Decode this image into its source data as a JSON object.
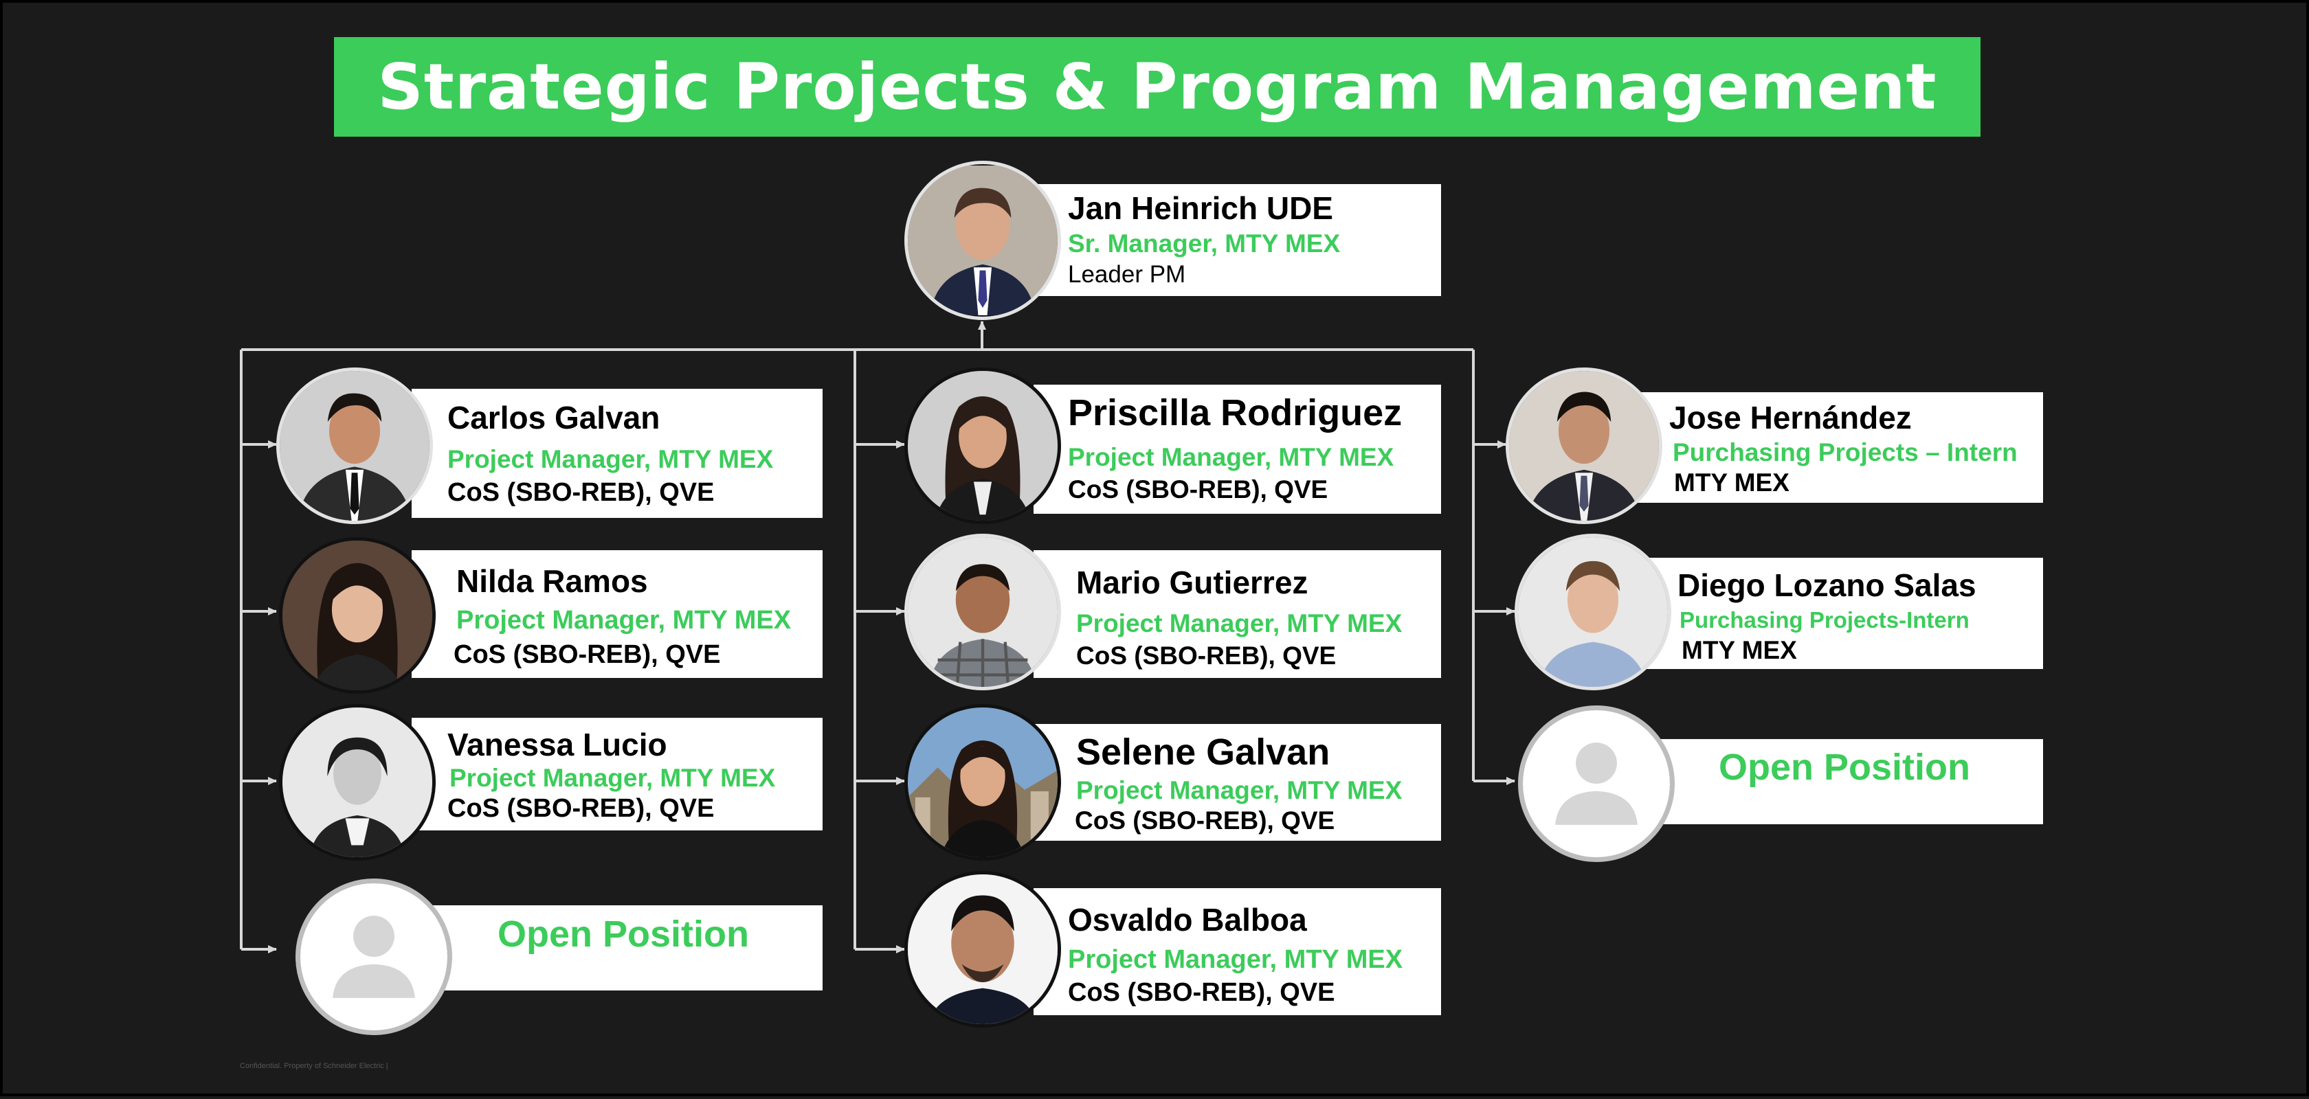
{
  "title": "Strategic Projects & Program Management",
  "colors": {
    "accent": "#3ccc5a",
    "background": "#1b1b1b",
    "card": "#ffffff",
    "connector": "#d8d8d8"
  },
  "footnote": "Confidential. Property of Schneider Electric |",
  "leader": {
    "name": "Jan Heinrich UDE",
    "role": "Sr. Manager, MTY MEX",
    "org": "Leader PM",
    "photo": "business-man-blue-tie"
  },
  "col1": [
    {
      "name": "Carlos Galvan",
      "role": "Project Manager, MTY MEX",
      "org": "CoS (SBO-REB), QVE",
      "photo": "man-suit"
    },
    {
      "name": "Nilda Ramos",
      "role": "Project Manager, MTY MEX",
      "org": "CoS (SBO-REB), QVE",
      "photo": "woman-dark-hair"
    },
    {
      "name": "Vanessa Lucio",
      "role": "Project Manager, MTY MEX",
      "org": "CoS (SBO-REB), QVE",
      "photo": "woman-grayscale"
    },
    {
      "open": "Open Position",
      "photo": "placeholder-person"
    }
  ],
  "col2": [
    {
      "name": "Priscilla Rodriguez",
      "role": "Project Manager, MTY MEX",
      "org": "CoS (SBO-REB), QVE",
      "photo": "woman-blazer"
    },
    {
      "name": "Mario Gutierrez",
      "role": "Project Manager, MTY MEX",
      "org": "CoS (SBO-REB), QVE",
      "photo": "man-plaid-shirt"
    },
    {
      "name": "Selene Galvan",
      "role": "Project Manager, MTY MEX",
      "org": "CoS (SBO-REB), QVE",
      "photo": "woman-city-background"
    },
    {
      "name": "Osvaldo Balboa",
      "role": "Project Manager, MTY MEX",
      "org": "CoS (SBO-REB), QVE",
      "photo": "man-white-background"
    }
  ],
  "col3": [
    {
      "name": "Jose Hernández",
      "role": "Purchasing Projects – Intern",
      "org": "MTY MEX",
      "photo": "young-man-suit"
    },
    {
      "name": "Diego Lozano Salas",
      "role": "Purchasing Projects-Intern",
      "org": "MTY MEX",
      "photo": "young-man-light-shirt"
    },
    {
      "open": "Open Position",
      "photo": "placeholder-person"
    }
  ]
}
